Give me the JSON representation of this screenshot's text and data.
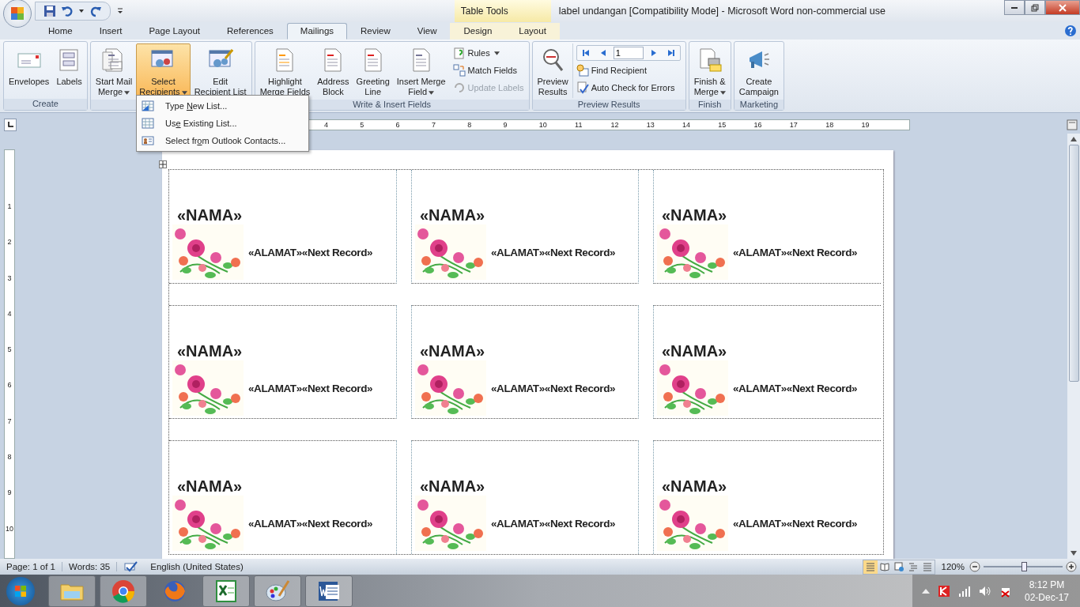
{
  "window": {
    "title": "label undangan [Compatibility Mode] - Microsoft Word non-commercial use",
    "context_tab": "Table Tools"
  },
  "tabs": [
    {
      "label": "Home",
      "selected": false,
      "contextual": false
    },
    {
      "label": "Insert",
      "selected": false,
      "contextual": false
    },
    {
      "label": "Page Layout",
      "selected": false,
      "contextual": false
    },
    {
      "label": "References",
      "selected": false,
      "contextual": false
    },
    {
      "label": "Mailings",
      "selected": true,
      "contextual": false
    },
    {
      "label": "Review",
      "selected": false,
      "contextual": false
    },
    {
      "label": "View",
      "selected": false,
      "contextual": false
    },
    {
      "label": "Design",
      "selected": false,
      "contextual": true
    },
    {
      "label": "Layout",
      "selected": false,
      "contextual": true
    }
  ],
  "ribbon_groups": [
    {
      "label": "Create",
      "buttons": [
        {
          "kind": "envelope",
          "label": "Envelopes",
          "dropdown": false,
          "selected": false
        },
        {
          "kind": "labels",
          "label": "Labels",
          "dropdown": false,
          "selected": false
        }
      ]
    },
    {
      "buttons": [
        {
          "kind": "docs",
          "label": "Start Mail\nMerge",
          "dropdown": true,
          "selected": false
        },
        {
          "kind": "recipients",
          "label": "Select\nRecipients",
          "dropdown": true,
          "selected": true
        },
        {
          "kind": "edit-list",
          "label": "Edit\nRecipient List",
          "dropdown": false,
          "selected": false
        }
      ]
    },
    {
      "label": "Write & Insert Fields",
      "buttons": [
        {
          "kind": "highlight",
          "label": "Highlight\nMerge Fields",
          "dropdown": false,
          "selected": false
        },
        {
          "kind": "address",
          "label": "Address\nBlock",
          "dropdown": false,
          "selected": false
        },
        {
          "kind": "greeting",
          "label": "Greeting\nLine",
          "dropdown": false,
          "selected": false
        },
        {
          "kind": "field",
          "label": "Insert Merge\nField",
          "dropdown": true,
          "selected": false
        }
      ],
      "small_buttons": [
        {
          "kind": "rules",
          "label": "Rules",
          "dropdown": true,
          "disabled": false
        },
        {
          "kind": "match",
          "label": "Match Fields",
          "dropdown": false,
          "disabled": false
        },
        {
          "kind": "update",
          "label": "Update Labels",
          "dropdown": false,
          "disabled": true
        }
      ]
    },
    {
      "label": "Preview Results",
      "buttons": [
        {
          "kind": "preview",
          "label": "Preview\nResults",
          "dropdown": false,
          "selected": false
        }
      ],
      "record": "1",
      "small_buttons": [
        {
          "kind": "find",
          "label": "Find Recipient",
          "dropdown": false,
          "disabled": false
        },
        {
          "kind": "check",
          "label": "Auto Check for Errors",
          "dropdown": false,
          "disabled": false
        }
      ]
    },
    {
      "label": "Finish",
      "buttons": [
        {
          "kind": "finish",
          "label": "Finish &\nMerge",
          "dropdown": true,
          "selected": false
        }
      ]
    },
    {
      "label": "Marketing",
      "buttons": [
        {
          "kind": "campaign",
          "label": "Create\nCampaign",
          "dropdown": false,
          "selected": false
        }
      ]
    }
  ],
  "dropdown_menu": [
    {
      "kind": "new-list",
      "label_parts": [
        "Type ",
        "N",
        "ew List..."
      ]
    },
    {
      "kind": "existing",
      "label_parts": [
        "Us",
        "e",
        " Existing List..."
      ]
    },
    {
      "kind": "contacts",
      "label_parts": [
        "Select fr",
        "o",
        "m Outlook Contacts..."
      ]
    }
  ],
  "ruler": {
    "numbers": [
      "4",
      "5",
      "6",
      "7",
      "8",
      "9",
      "10",
      "11",
      "12",
      "13",
      "14",
      "15",
      "16",
      "17",
      "18",
      "19"
    ],
    "vertical_numbers": [
      "1",
      "2",
      "3",
      "4",
      "5",
      "6",
      "7",
      "8",
      "9",
      "10"
    ]
  },
  "label_rows": [
    [
      {
        "name": "«NAMA»",
        "address": "«ALAMAT»«Next Record»"
      },
      {
        "name": "«NAMA»",
        "address": "«ALAMAT»«Next Record»"
      },
      {
        "name": "«NAMA»",
        "address": "«ALAMAT»«Next Record»"
      }
    ],
    [
      {
        "name": "«NAMA»",
        "address": "«ALAMAT»«Next Record»"
      },
      {
        "name": "«NAMA»",
        "address": "«ALAMAT»«Next Record»"
      },
      {
        "name": "«NAMA»",
        "address": "«ALAMAT»«Next Record»"
      }
    ],
    [
      {
        "name": "«NAMA»",
        "address": "«ALAMAT»«Next Record»"
      },
      {
        "name": "«NAMA»",
        "address": "«ALAMAT»«Next Record»"
      },
      {
        "name": "«NAMA»",
        "address": "«ALAMAT»«Next Record»"
      }
    ]
  ],
  "status_bar": {
    "page": "Page: 1 of 1",
    "words": "Words: 35",
    "language": "English (United States)",
    "views": [
      {
        "kind": "print",
        "selected": true
      },
      {
        "kind": "reading",
        "selected": false
      },
      {
        "kind": "web",
        "selected": false
      },
      {
        "kind": "outline",
        "selected": false
      },
      {
        "kind": "draft",
        "selected": false
      }
    ],
    "zoom": "120%",
    "zoom_slider": {
      "level": 0.51
    }
  },
  "taskbar": {
    "apps": [
      {
        "kind": "explorer",
        "running": true
      },
      {
        "kind": "chrome",
        "running": true
      },
      {
        "kind": "firefox",
        "running": false
      },
      {
        "kind": "excel",
        "running": true
      },
      {
        "kind": "paint",
        "running": true
      },
      {
        "kind": "word",
        "running": true
      }
    ],
    "time": "8:12 PM",
    "date": "02-Dec-17"
  }
}
